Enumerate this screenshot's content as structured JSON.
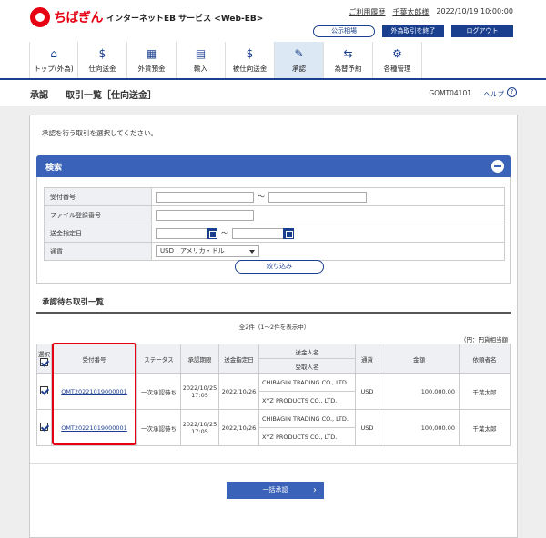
{
  "header": {
    "logo_text": "ちばぎん",
    "service_name": "インターネットEB サービス <Web-EB>",
    "usage_history": "ご利用履歴",
    "user_name": "千葉太郎様",
    "datetime": "2022/10/19 10:00:00",
    "public_rate": "公示相場",
    "fx_end": "外為取引を終了",
    "logout": "ログアウト"
  },
  "nav": [
    {
      "label": "トップ(外為)",
      "icon": "home-icon"
    },
    {
      "label": "仕向送金",
      "icon": "send-icon"
    },
    {
      "label": "外貨預金",
      "icon": "deposit-icon"
    },
    {
      "label": "輸入",
      "icon": "import-icon"
    },
    {
      "label": "被仕向送金",
      "icon": "receive-icon"
    },
    {
      "label": "承認",
      "icon": "approve-icon",
      "active": true
    },
    {
      "label": "為替予約",
      "icon": "contract-icon"
    },
    {
      "label": "各種管理",
      "icon": "settings-icon"
    }
  ],
  "page": {
    "section": "承認",
    "title": "取引一覧［仕向送金］",
    "code": "GOMT04101",
    "help": "ヘルプ"
  },
  "intro": "承認を行う取引を選択してください。",
  "search": {
    "title": "検索",
    "fields": {
      "receipt_no": "受付番号",
      "file_no": "ファイル登録番号",
      "date": "送金指定日",
      "currency": "通貨"
    },
    "tilde": "～",
    "currency_value": "USD　アメリカ・ドル",
    "narrow_button": "絞り込み"
  },
  "list": {
    "title": "承認待ち取引一覧",
    "count": "全2件（1～2件を表示中）",
    "unit": "（円：円貨相当額",
    "headers": {
      "select": "選択",
      "receipt_no": "受付番号",
      "status": "ステータス",
      "deadline": "承認期限",
      "send_date": "送金指定日",
      "sender": "送金人名",
      "receiver": "受取人名",
      "currency": "通貨",
      "amount": "金額",
      "requester": "依頼者名"
    },
    "rows": [
      {
        "receipt_no": "OMT20221019000001",
        "status": "一次承認待ち",
        "deadline_date": "2022/10/25",
        "deadline_time": "17:05",
        "send_date": "2022/10/26",
        "sender": "CHIBAGIN TRADING CO., LTD.",
        "receiver": "XYZ PRODUCTS CO., LTD.",
        "currency": "USD",
        "amount": "100,000.00",
        "requester": "千葉太郎"
      },
      {
        "receipt_no": "OMT20221019000001",
        "status": "一次承認待ち",
        "deadline_date": "2022/10/25",
        "deadline_time": "17:05",
        "send_date": "2022/10/26",
        "sender": "CHIBAGIN TRADING CO., LTD.",
        "receiver": "XYZ PRODUCTS CO., LTD.",
        "currency": "USD",
        "amount": "100,000.00",
        "requester": "千葉太郎"
      }
    ]
  },
  "approve_all": "一括承認"
}
